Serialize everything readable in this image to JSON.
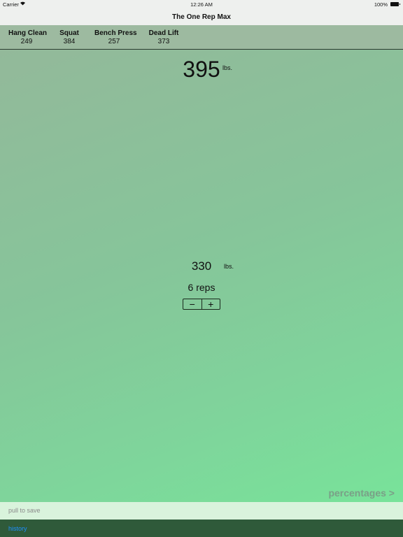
{
  "status_bar": {
    "carrier": "Carrier",
    "time": "12:26 AM",
    "battery": "100%"
  },
  "nav": {
    "title": "The One Rep Max"
  },
  "lifts": [
    {
      "name": "Hang Clean",
      "value": "249"
    },
    {
      "name": "Squat",
      "value": "384"
    },
    {
      "name": "Bench Press",
      "value": "257"
    },
    {
      "name": "Dead Lift",
      "value": "373"
    }
  ],
  "max": {
    "value": "395",
    "unit": "lbs."
  },
  "rep": {
    "weight": "330",
    "unit": "lbs.",
    "count": "6 reps"
  },
  "stepper": {
    "minus": "−",
    "plus": "+"
  },
  "links": {
    "percentages": "percentages >",
    "pull_to_save": "pull to save",
    "history": "history"
  },
  "colors": {
    "accent_link": "#1e90ff",
    "bottom_bar": "#2f5a3a",
    "percentages": "#7a9f87"
  }
}
